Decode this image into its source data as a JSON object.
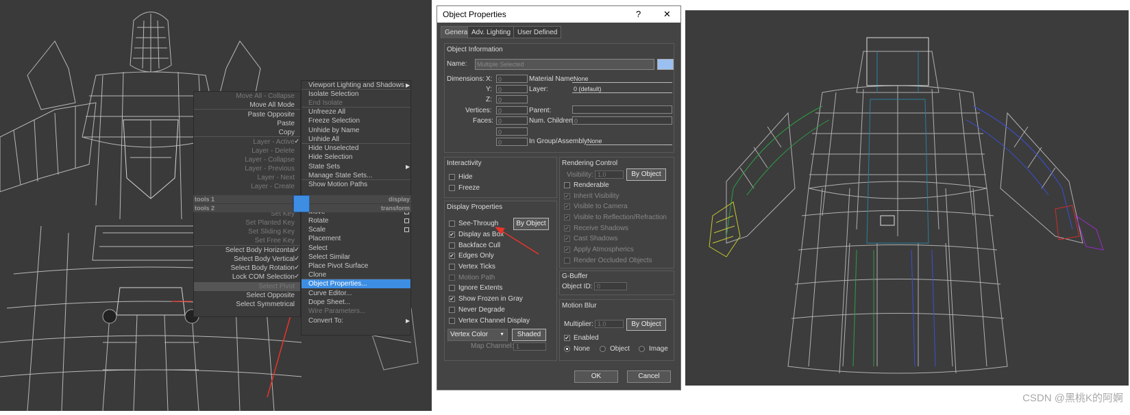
{
  "quad_left": {
    "items": [
      {
        "label": "Move All - Collapse",
        "dim": true
      },
      {
        "label": "Move All Mode",
        "dim": false
      },
      {
        "label": "Paste Opposite",
        "dim": false
      },
      {
        "label": "Paste",
        "dim": false
      },
      {
        "label": "Copy",
        "dim": false
      },
      {
        "label": "Layer - Active",
        "dim": true,
        "check": true
      },
      {
        "label": "Layer - Delete",
        "dim": true
      },
      {
        "label": "Layer - Collapse",
        "dim": true
      },
      {
        "label": "Layer - Previous",
        "dim": true
      },
      {
        "label": "Layer - Next",
        "dim": true
      },
      {
        "label": "Layer - Create",
        "dim": true
      },
      {
        "label": "Set Key",
        "dim": true
      },
      {
        "label": "Set Planted Key",
        "dim": true
      },
      {
        "label": "Set Sliding Key",
        "dim": true
      },
      {
        "label": "Set Free Key",
        "dim": true
      },
      {
        "label": "Select Body Horizontal",
        "dim": false,
        "check": true
      },
      {
        "label": "Select Body Vertical",
        "dim": false,
        "check": true
      },
      {
        "label": "Select Body Rotation",
        "dim": false,
        "check": true
      },
      {
        "label": "Lock COM Selection",
        "dim": false,
        "check": true
      },
      {
        "label": "Select Pivot",
        "dim": true
      },
      {
        "label": "Select Opposite",
        "dim": false
      },
      {
        "label": "Select Symmetrical",
        "dim": false
      }
    ],
    "header_top": "tools 1",
    "header_bottom": "tools 2"
  },
  "quad_right": {
    "items": [
      {
        "label": "Viewport Lighting and Shadows",
        "arrow": true
      },
      {
        "label": "Isolate Selection"
      },
      {
        "label": "End Isolate",
        "dim": true
      },
      {
        "label": "Unfreeze All"
      },
      {
        "label": "Freeze Selection"
      },
      {
        "label": "Unhide by Name"
      },
      {
        "label": "Unhide All"
      },
      {
        "label": "Hide Unselected"
      },
      {
        "label": "Hide Selection"
      },
      {
        "label": "State Sets",
        "arrow": true
      },
      {
        "label": "Manage State Sets..."
      },
      {
        "label": "Show Motion Paths"
      },
      {
        "label": "Move",
        "box": true
      },
      {
        "label": "Rotate",
        "box": true
      },
      {
        "label": "Scale",
        "box": true
      },
      {
        "label": "Placement"
      },
      {
        "label": "Select"
      },
      {
        "label": "Select Similar"
      },
      {
        "label": "Place Pivot Surface"
      },
      {
        "label": "Clone"
      },
      {
        "label": "Object Properties...",
        "selected": true
      },
      {
        "label": "Curve Editor..."
      },
      {
        "label": "Dope Sheet..."
      },
      {
        "label": "Wire Parameters...",
        "dim": true
      },
      {
        "label": "Convert To:",
        "arrow": true
      }
    ],
    "header_top": "display",
    "header_bottom": "transform"
  },
  "dialog": {
    "title": "Object Properties",
    "help": "?",
    "close": "✕",
    "tabs": [
      "General",
      "Adv. Lighting",
      "User Defined"
    ],
    "object_info": {
      "title": "Object Information",
      "name_label": "Name:",
      "name_value": "Multiple Selected",
      "dimensions_label": "Dimensions:",
      "x": "X:",
      "y": "Y:",
      "z": "Z:",
      "dx": "0",
      "dy": "0",
      "dz": "0",
      "vertices_label": "Vertices:",
      "vertices": "0",
      "faces_label": "Faces:",
      "faces": "0",
      "extra1": "0",
      "extra2": "0",
      "material_label": "Material Name:",
      "material": "None",
      "layer_label": "Layer:",
      "layer": "0 (default)",
      "parent_label": "Parent:",
      "parent": "",
      "children_label": "Num. Children:",
      "children": "0",
      "group_label": "In Group/Assembly:",
      "group": "None"
    },
    "interactivity": {
      "title": "Interactivity",
      "hide": "Hide",
      "freeze": "Freeze"
    },
    "display_props": {
      "title": "Display Properties",
      "see_through": "See-Through",
      "by_object": "By Object",
      "display_as_box": "Display as Box",
      "backface_cull": "Backface Cull",
      "edges_only": "Edges Only",
      "vertex_ticks": "Vertex Ticks",
      "motion_path": "Motion Path",
      "ignore_extents": "Ignore Extents",
      "show_frozen_gray": "Show Frozen in Gray",
      "never_degrade": "Never Degrade",
      "vertex_channel": "Vertex Channel Display",
      "vertex_color": "Vertex Color",
      "shaded": "Shaded",
      "map_channel_label": "Map Channel:",
      "map_channel": "1"
    },
    "rendering": {
      "title": "Rendering Control",
      "visibility_label": "Visibility:",
      "visibility": "1.0",
      "by_object": "By Object",
      "renderable": "Renderable",
      "inherit_visibility": "Inherit Visibility",
      "visible_camera": "Visible to Camera",
      "visible_reflection": "Visible to Reflection/Refraction",
      "receive_shadows": "Receive Shadows",
      "cast_shadows": "Cast Shadows",
      "apply_atmo": "Apply Atmospherics",
      "render_occluded": "Render Occluded Objects"
    },
    "gbuffer": {
      "title": "G-Buffer",
      "object_id_label": "Object ID:",
      "object_id": "0"
    },
    "motion_blur": {
      "title": "Motion Blur",
      "multiplier_label": "Multiplier:",
      "multiplier": "1.0",
      "by_object": "By Object",
      "enabled": "Enabled",
      "none": "None",
      "object": "Object",
      "image": "Image"
    },
    "ok": "OK",
    "cancel": "Cancel"
  },
  "credit": "CSDN @黑桃K的阿婀",
  "colors": {
    "menu_selected": "#3d8ee3",
    "arrow": "#e8342a",
    "viewport_bg": "#3a3a3a"
  }
}
